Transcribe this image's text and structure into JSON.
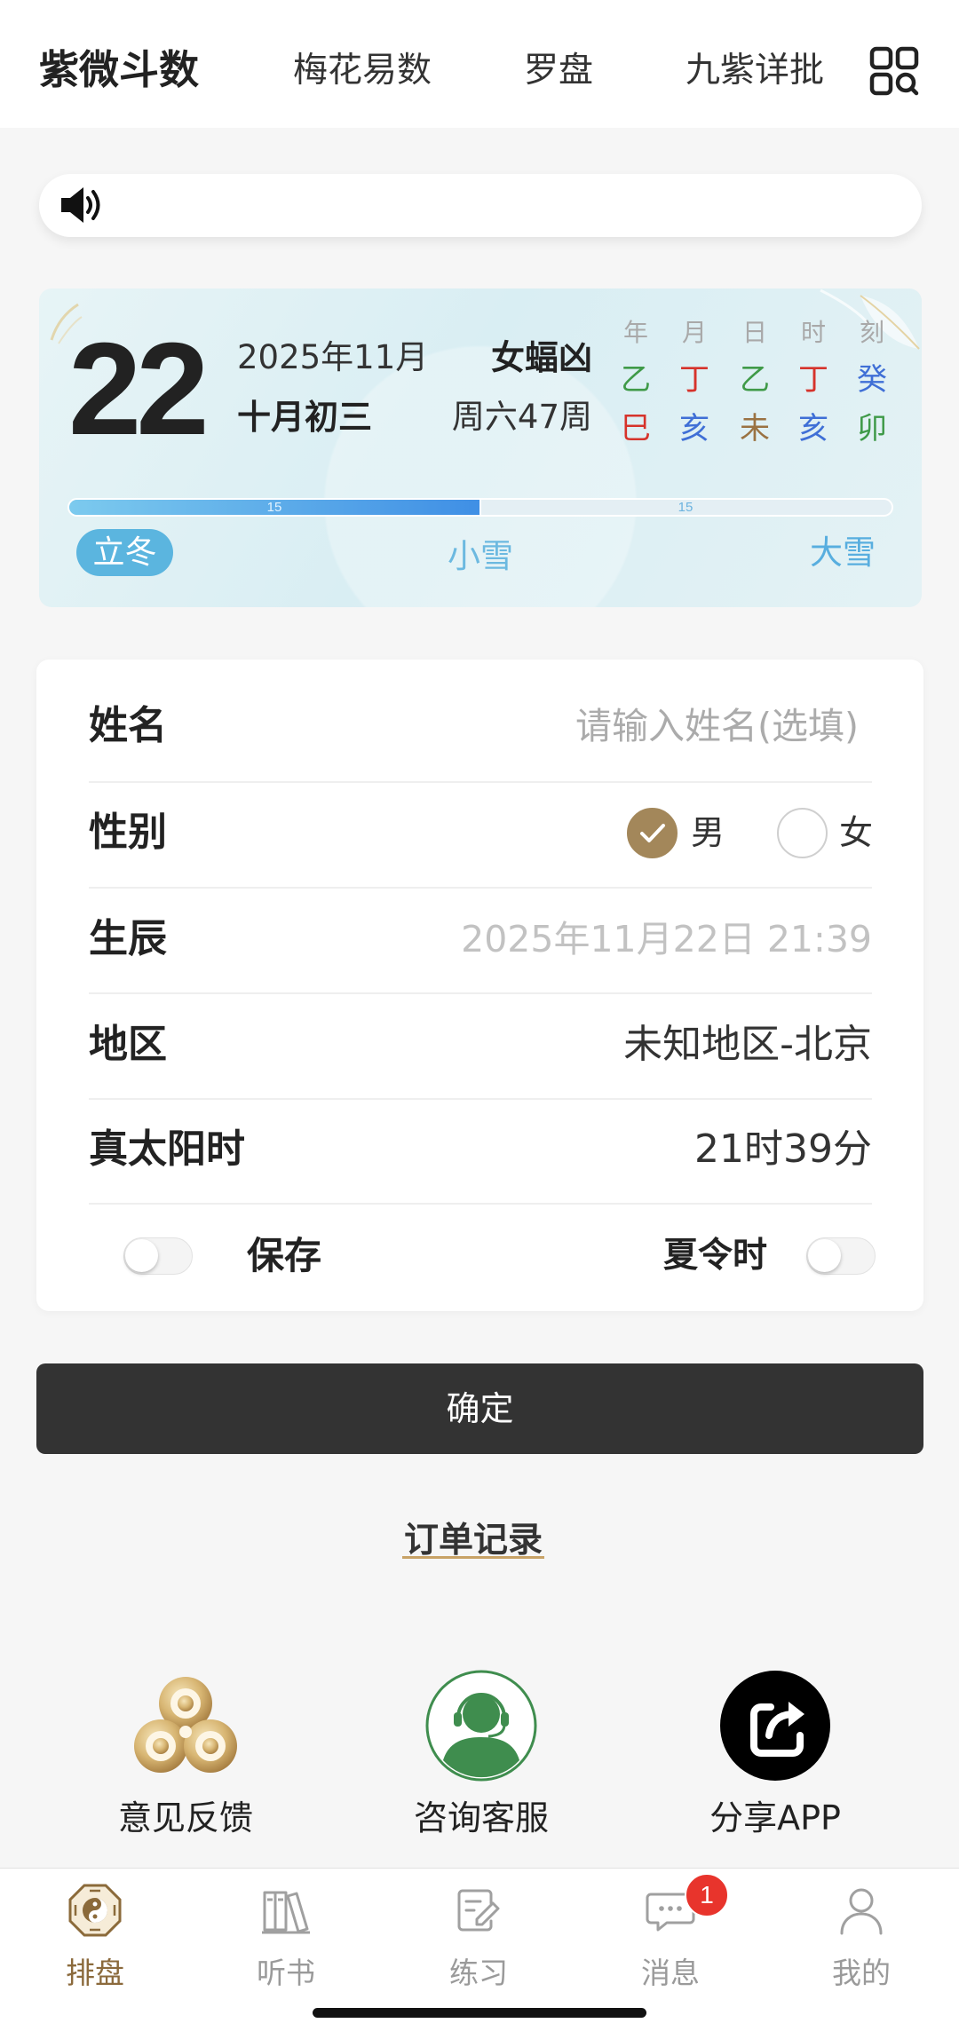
{
  "nav": {
    "tabs": [
      {
        "label": "紫微斗数",
        "active": true
      },
      {
        "label": "梅花易数",
        "active": false
      },
      {
        "label": "罗盘",
        "active": false
      },
      {
        "label": "九紫详批",
        "active": false
      }
    ],
    "menu_icon": "grid-search-icon"
  },
  "notice": {
    "icon": "speaker-icon"
  },
  "calendar": {
    "day": "22",
    "solar_month": "2025年11月",
    "lunar_date": "十月初三",
    "omen": "女蝠凶",
    "week": "周六47周",
    "pillars": {
      "headers": [
        "年",
        "月",
        "日",
        "时",
        "刻"
      ],
      "stems": [
        {
          "char": "乙",
          "color": "#3f9a48"
        },
        {
          "char": "丁",
          "color": "#d6332b"
        },
        {
          "char": "乙",
          "color": "#3f9a48"
        },
        {
          "char": "丁",
          "color": "#d6332b"
        },
        {
          "char": "癸",
          "color": "#3f6fd6"
        }
      ],
      "branches": [
        {
          "char": "巳",
          "color": "#d6332b"
        },
        {
          "char": "亥",
          "color": "#3f6fd6"
        },
        {
          "char": "未",
          "color": "#9a7242"
        },
        {
          "char": "亥",
          "color": "#3f6fd6"
        },
        {
          "char": "卯",
          "color": "#3f9a48"
        }
      ]
    },
    "term_progress": {
      "segments": [
        "15",
        "15"
      ],
      "fraction": 0.5
    },
    "terms": {
      "previous": "立冬",
      "current": "小雪",
      "next": "大雪"
    }
  },
  "form": {
    "name": {
      "label": "姓名",
      "placeholder": "请输入姓名(选填)"
    },
    "gender": {
      "label": "性别",
      "options": [
        {
          "label": "男",
          "checked": true
        },
        {
          "label": "女",
          "checked": false
        }
      ]
    },
    "birth": {
      "label": "生辰",
      "value": "2025年11月22日 21:39"
    },
    "region": {
      "label": "地区",
      "value": "未知地区-北京"
    },
    "true_solar_time": {
      "label": "真太阳时",
      "value": "21时39分"
    },
    "save": {
      "label": "保存",
      "enabled": false
    },
    "daylight_saving": {
      "label": "夏令时",
      "enabled": false
    }
  },
  "confirm_label": "确定",
  "order_link": "订单记录",
  "shortcuts": [
    {
      "label": "意见反馈",
      "icon": "feedback-logo-icon"
    },
    {
      "label": "咨询客服",
      "icon": "customer-service-icon"
    },
    {
      "label": "分享APP",
      "icon": "share-icon"
    }
  ],
  "tabbar": [
    {
      "label": "排盘",
      "icon": "bagua-icon",
      "active": true
    },
    {
      "label": "听书",
      "icon": "books-icon",
      "active": false
    },
    {
      "label": "练习",
      "icon": "exercise-icon",
      "active": false
    },
    {
      "label": "消息",
      "icon": "chat-icon",
      "active": false,
      "badge": "1"
    },
    {
      "label": "我的",
      "icon": "user-icon",
      "active": false
    }
  ],
  "colors": {
    "accent": "#a3875a",
    "button": "#333333",
    "active_tab": "#8b6a3c",
    "badge": "#e8342c",
    "term_blue": "#5bb5df"
  }
}
